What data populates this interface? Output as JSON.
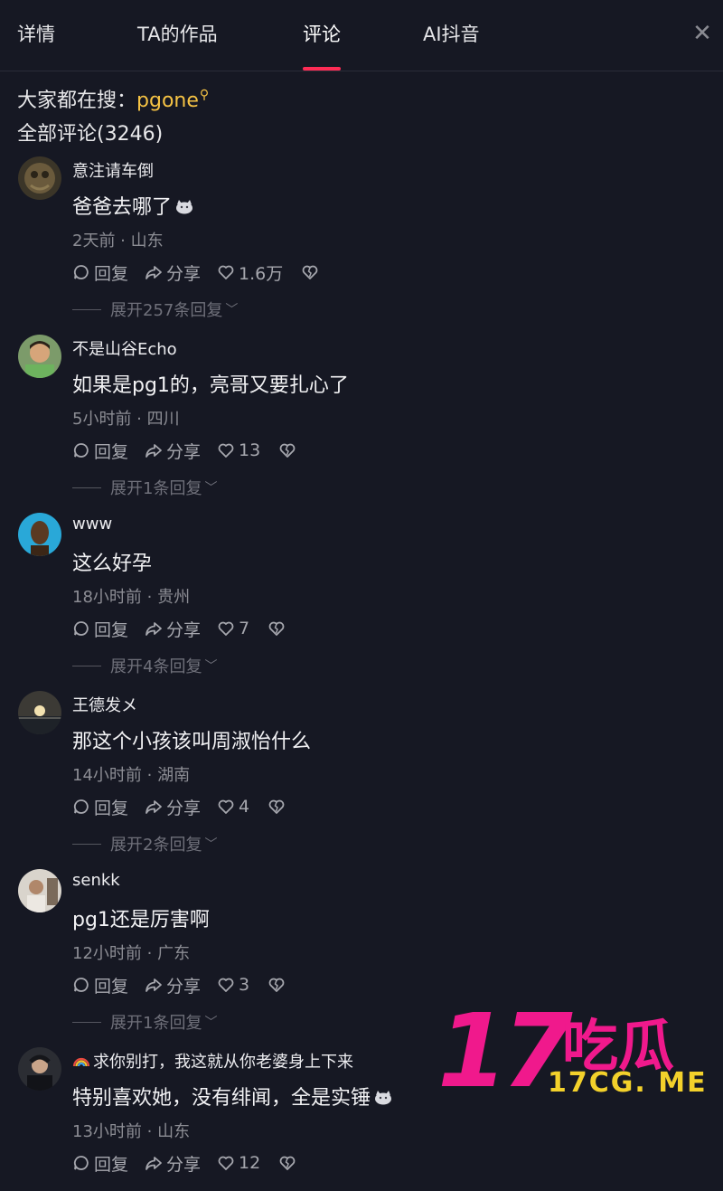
{
  "tabs": [
    "详情",
    "TA的作品",
    "评论",
    "AI抖音"
  ],
  "active_tab": "评论",
  "search_hint": {
    "label": "大家都在搜：",
    "keyword": "pgone"
  },
  "comments_title": "全部评论(3246)",
  "actions": {
    "reply": "回复",
    "share": "分享"
  },
  "comments": [
    {
      "username": "意注请车倒",
      "text": "爸爸去哪了",
      "emoji": "cat-emoji",
      "meta": "2天前 · 山东",
      "likes": "1.6万",
      "expand": "展开257条回复"
    },
    {
      "username": "不是山谷Echo",
      "text": "如果是pg1的，亮哥又要扎心了",
      "meta": "5小时前 · 四川",
      "likes": "13",
      "expand": "展开1条回复"
    },
    {
      "username": "www",
      "text": "这么好孕",
      "meta": "18小时前 · 贵州",
      "likes": "7",
      "expand": "展开4条回复"
    },
    {
      "username": "王德发メ",
      "text": "那这个小孩该叫周淑怡什么",
      "meta": "14小时前 · 湖南",
      "likes": "4",
      "expand": "展开2条回复"
    },
    {
      "username": "senkk",
      "text": "pg1还是厉害啊",
      "meta": "12小时前 · 广东",
      "likes": "3",
      "expand": "展开1条回复"
    },
    {
      "username": "求你别打，我这就从你老婆身上下来",
      "text": "特别喜欢她，没有绯闻，全是实锤",
      "emoji": "cat-emoji",
      "meta": "13小时前 · 山东",
      "likes": "12"
    }
  ],
  "watermark": {
    "number": "17",
    "text": "吃瓜",
    "site": "17CG. ME"
  },
  "colors": {
    "background": "#161823",
    "accent": "#fe2c55",
    "keyword": "#f6c344",
    "watermark_pink": "#f0198c",
    "watermark_yellow": "#f3d12b"
  }
}
